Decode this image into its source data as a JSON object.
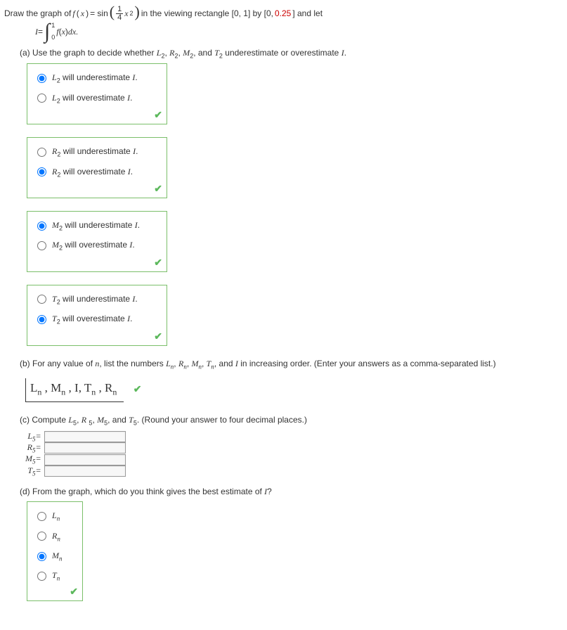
{
  "header": {
    "pre": "Draw the graph of ",
    "fx_left": "f",
    "open_paren": "(",
    "x_var": "x",
    "close_paren": ")",
    "eq": " = sin",
    "frac_num": "1",
    "frac_den": "4",
    "xsq": "x",
    "sq": "2",
    "post1": " in the viewing rectangle [0, 1] by [0, ",
    "red_val": "0.25",
    "post2": "] and let"
  },
  "integral": {
    "I": "I",
    "eq": " = ",
    "upper": "1",
    "lower": "0",
    "fx": "f",
    "x": "x",
    "dx": " dx."
  },
  "parts": {
    "a": "(a) Use the graph to decide whether ",
    "a_syms": [
      "L",
      "R",
      "M",
      "T"
    ],
    "a_post": " underestimate or overestimate ",
    "a_end": ".",
    "b": "(b) For any value of ",
    "b_mid": ", list the numbers ",
    "b_syms": [
      "L",
      "R",
      "M",
      "T"
    ],
    "b_and": " and ",
    "b_post": " in increasing order. (Enter your answers as a comma-separated list.)",
    "c": "(c) Compute ",
    "c_syms": [
      "L",
      "R",
      "M",
      "T"
    ],
    "c_and": " and ",
    "c_post": ". (Round your answer to four decimal places.)",
    "d": "(d) From the graph, which do you think gives the best estimate of ",
    "d_end": "?"
  },
  "radios": {
    "groups": [
      {
        "sym": "L",
        "opt1": " will underestimate ",
        "opt2": " will overestimate ",
        "selected": 0
      },
      {
        "sym": "R",
        "opt1": " will underestimate ",
        "opt2": " will overestimate ",
        "selected": 1
      },
      {
        "sym": "M",
        "opt1": " will underestimate ",
        "opt2": " will overestimate ",
        "selected": 0
      },
      {
        "sym": "T",
        "opt1": " will underestimate ",
        "opt2": " will overestimate ",
        "selected": 1
      }
    ],
    "sub": "2",
    "Ivar": "I",
    "dot": "."
  },
  "answer_b": {
    "tokens": [
      "L",
      " ,",
      "M",
      " ,",
      "I",
      ",",
      "T",
      " ,",
      "R"
    ],
    "sub": "n"
  },
  "compute": {
    "rows": [
      "L",
      "R",
      "M",
      "T"
    ],
    "sub": "5",
    "eq": "="
  },
  "radios_d": {
    "opts": [
      "L",
      "R",
      "M",
      "T"
    ],
    "sub": "n",
    "selected": 2
  },
  "n_var": "n",
  "I_var": "I"
}
